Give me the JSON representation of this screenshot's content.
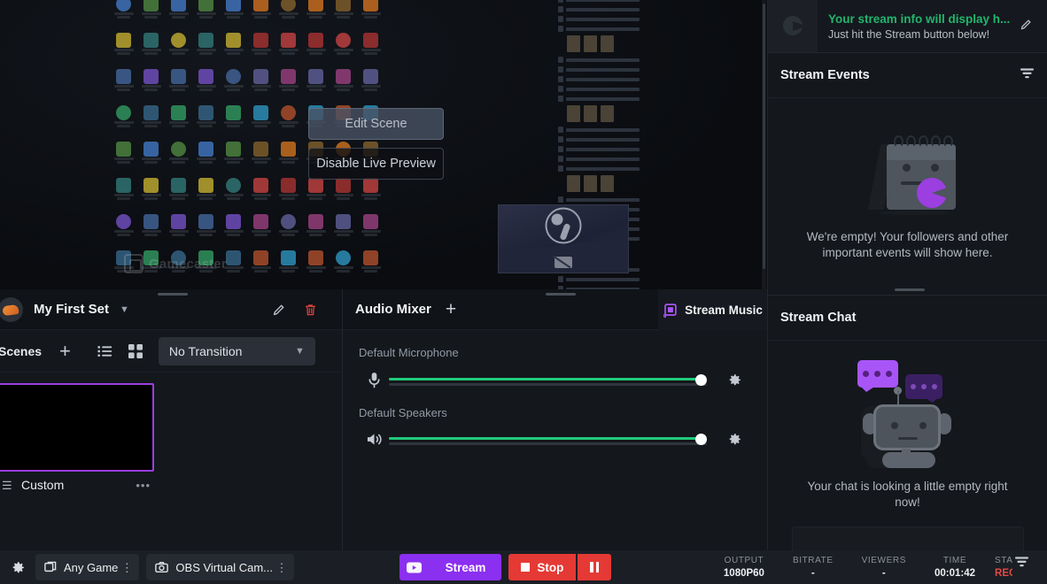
{
  "preview": {
    "edit_scene_label": "Edit Scene",
    "disable_preview_label": "Disable Live Preview",
    "watermark": "Gamecaster"
  },
  "scene_panel": {
    "set_name": "My First Set",
    "dropdown_icon": "chevron-down-icon",
    "edit_icon": "pencil-icon",
    "delete_icon": "trash-icon",
    "section_label": "Scenes",
    "add_icon": "plus-icon",
    "list_view_icon": "list-view-icon",
    "grid_view_icon": "grid-view-icon",
    "transition": "No Transition",
    "scenes": [
      {
        "name": "Custom",
        "more_icon": "more-dots-icon",
        "grip_icon": "drag-grip-icon"
      }
    ]
  },
  "mixer": {
    "title": "Audio Mixer",
    "add_icon": "plus-icon",
    "stream_music_label": "Stream Music",
    "stream_music_icon": "music-note-icon",
    "channels": [
      {
        "label": "Default Microphone",
        "icon": "microphone-icon",
        "volume": 100,
        "settings_icon": "gear-icon"
      },
      {
        "label": "Default Speakers",
        "icon": "speaker-icon",
        "volume": 100,
        "settings_icon": "gear-icon"
      }
    ]
  },
  "stream_info": {
    "title": "Your stream info will display h...",
    "subtitle": "Just hit the Stream button below!",
    "edit_icon": "pencil-icon"
  },
  "stream_events": {
    "title": "Stream Events",
    "filter_icon": "filter-icon",
    "empty_message": "We're empty! Your followers and other important events will show here."
  },
  "stream_chat": {
    "title": "Stream Chat",
    "empty_message": "Your chat is looking a little empty right now!",
    "input_placeholder": ""
  },
  "bottom_bar": {
    "settings_icon": "gear-icon",
    "sources": [
      {
        "label": "Any Game",
        "icon": "window-capture-icon",
        "more_icon": "more-vertical-icon"
      },
      {
        "label": "OBS Virtual Cam...",
        "icon": "camera-icon",
        "more_icon": "more-vertical-icon"
      }
    ],
    "youtube_icon": "youtube-icon",
    "stream_label": "Stream",
    "stop_label": "Stop",
    "stop_icon": "stop-square-icon",
    "pause_icon": "pause-icon",
    "stats": [
      {
        "key": "OUTPUT",
        "value": "1080P60"
      },
      {
        "key": "BITRATE",
        "value": "-"
      },
      {
        "key": "VIEWERS",
        "value": "-"
      },
      {
        "key": "TIME",
        "value": "00:01:42"
      },
      {
        "key": "STA",
        "value": "REC"
      }
    ],
    "stats_filter_icon": "filter-icon"
  },
  "colors": {
    "accent_purple": "#8b2ff0",
    "scene_selected_border": "#9b3fe0",
    "volume_green": "#21c97a",
    "stop_red": "#e53935",
    "live_green": "#21b56c",
    "rec_red": "#e04a45"
  }
}
